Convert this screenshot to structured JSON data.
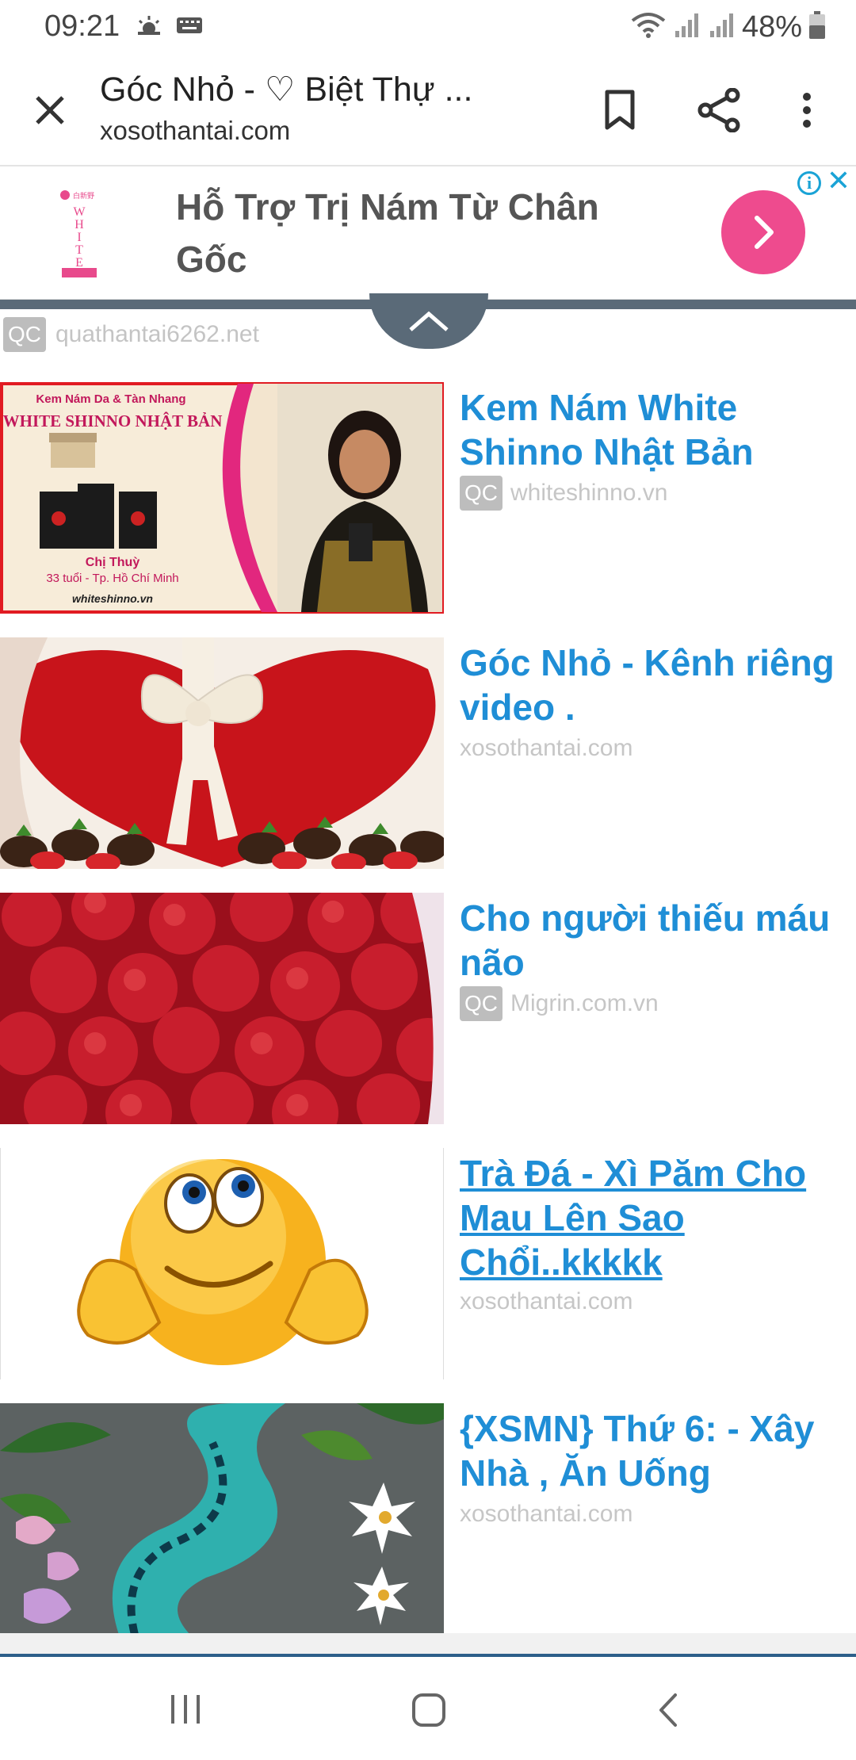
{
  "status_bar": {
    "time": "09:21",
    "battery": "48%",
    "icons": [
      "weather-icon",
      "keyboard-icon",
      "wifi-icon",
      "signal-icon",
      "battery-icon"
    ]
  },
  "browser": {
    "title": "Góc Nhỏ - ♡ Biệt Thự ...",
    "domain": "xosothantai.com",
    "icons": [
      "close-icon",
      "bookmark-icon",
      "share-icon",
      "more-icon"
    ]
  },
  "banner_ad": {
    "headline": "Hỗ Trợ Trị Nám Từ Chân Gốc",
    "button_icon": "chevron-right-icon",
    "accent_color": "#ee4b8e"
  },
  "sponsor": {
    "badge": "QC",
    "domain": "quathantai6262.net"
  },
  "articles": [
    {
      "title": "Kem Nám White Shinno Nhật Bản",
      "badge": "QC",
      "source": "whiteshinno.vn",
      "thumb": {
        "line1": "Kem Nám Da & Tàn Nhang",
        "line2": "WHITE SHINNO NHẬT BẢN",
        "person": "Chị Thuỳ",
        "detail": "33 tuổi - Tp. Hồ Chí Minh",
        "site": "whiteshinno.vn"
      }
    },
    {
      "title": "Góc Nhỏ - Kênh riêng video .",
      "badge": "",
      "source": "xosothantai.com"
    },
    {
      "title": "Cho người thiếu máu não",
      "badge": "QC",
      "source": "Migrin.com.vn"
    },
    {
      "title": "Trà Đá - Xì Păm Cho Mau Lên Sao Chổi..kkkkk",
      "badge": "",
      "source": "xosothantai.com"
    },
    {
      "title": "{XSMN} Thứ 6: - Xây Nhà , Ăn Uống",
      "badge": "",
      "source": "xosothantai.com"
    }
  ],
  "colors": {
    "link": "#1f8ed6",
    "muted": "#c6c6c6",
    "divider": "#5a6a78"
  }
}
